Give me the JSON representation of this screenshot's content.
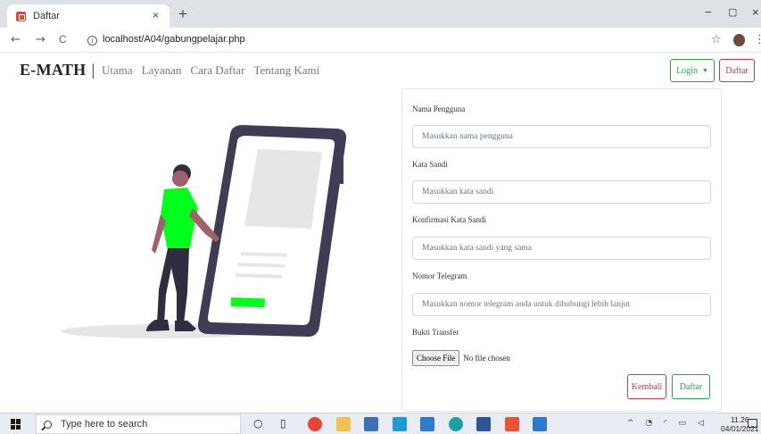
{
  "browser": {
    "tab_title": "Daftar",
    "tab_close": "×",
    "new_tab": "+",
    "minimize": "−",
    "maximize": "▢",
    "close_window": "×",
    "back": "←",
    "forward": "→",
    "reload": "C",
    "url": "localhost/A04/gabungpelajar.php",
    "bookmark_star": "☆",
    "menu": "⋮"
  },
  "navbar": {
    "brand": "E-MATH",
    "brand_sep": "|",
    "links": [
      "Utama",
      "Layanan",
      "Cara Daftar",
      "Tentang Kami"
    ],
    "login_label": "Login",
    "login_caret": "▼",
    "daftar_label": "Daftar"
  },
  "form": {
    "username_label": "Nama Pengguna",
    "username_placeholder": "Masukkan nama pengguna",
    "password_label": "Kata Sandi",
    "password_placeholder": "Masukkan kata sandi",
    "confirm_label": "Konfirmasi Kata Sandi",
    "confirm_placeholder": "Masukkan kata sandi yang sama",
    "telegram_label": "Nomor Telegram",
    "telegram_placeholder": "Masukkan nomor telegram anda untuk dihubungi lebih lanjut",
    "transfer_label": "Bukti Transfer",
    "file_button": "Choose File",
    "file_status": "No file chosen",
    "back_button": "Kembali",
    "submit_button": "Daftar"
  },
  "taskbar": {
    "search_placeholder": "Type here to search",
    "time": "11.26",
    "date": "04/01/2021"
  },
  "colors": {
    "accent_green": "#28a745",
    "accent_red": "#dc3545",
    "illustration_green": "#00ff1a",
    "phone_frame": "#3f3d56"
  }
}
